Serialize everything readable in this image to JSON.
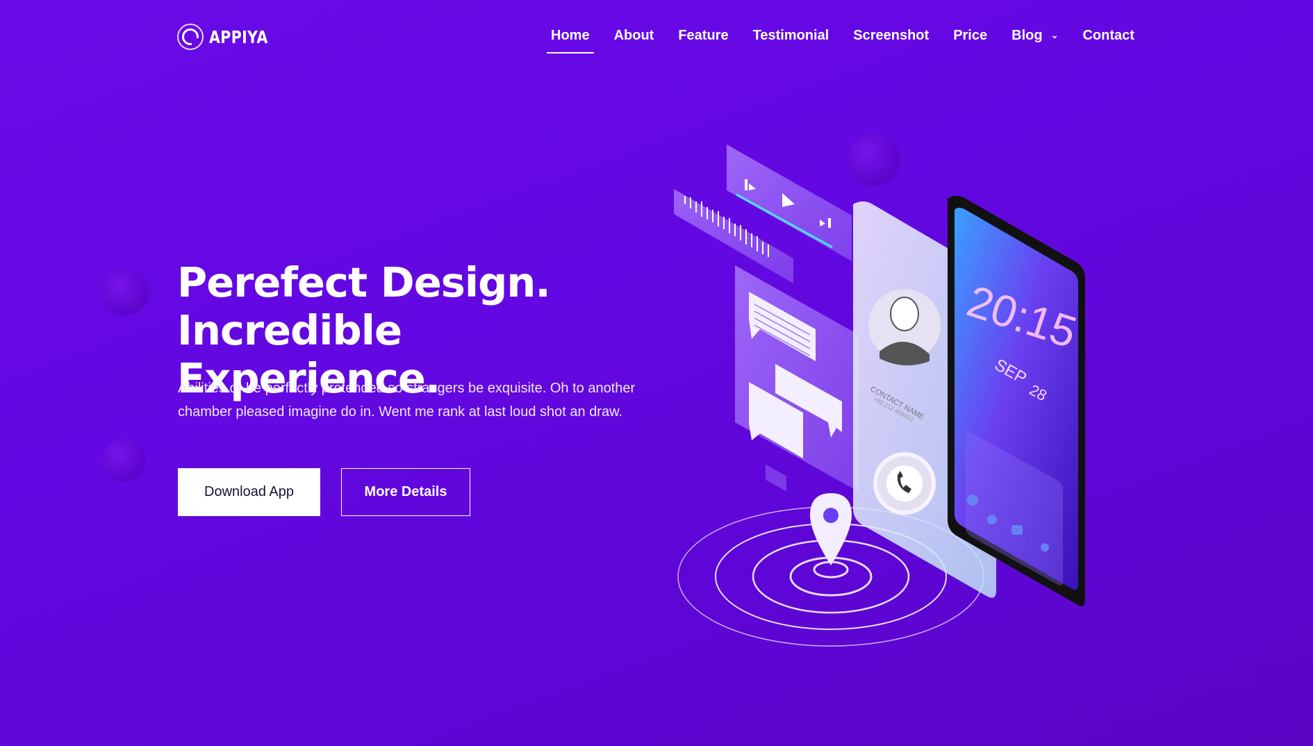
{
  "brand": {
    "name": "APPIYA",
    "logo_icon": "appiya-logo-icon"
  },
  "nav": {
    "items": [
      {
        "label": "Home",
        "active": true
      },
      {
        "label": "About"
      },
      {
        "label": "Feature"
      },
      {
        "label": "Testimonial"
      },
      {
        "label": "Screenshot"
      },
      {
        "label": "Price"
      },
      {
        "label": "Blog",
        "has_dropdown": true
      },
      {
        "label": "Contact"
      }
    ]
  },
  "hero": {
    "title_line1": "Perefect Design.",
    "title_line2": "Incredible Experience.",
    "description": "Abilities or he perfectly pretended so strangers be exquisite. Oh to another chamber pleased imagine do in. Went me rank at last loud shot an draw.",
    "primary_button": "Download App",
    "secondary_button": "More Details"
  },
  "illustration": {
    "clock": "20:15",
    "month": "SEP",
    "day": "28",
    "contact_label": "CONTACT NAME",
    "contact_phone": "+98 212 456852"
  },
  "colors": {
    "background": "#6308e2",
    "accent": "#ffffff"
  }
}
